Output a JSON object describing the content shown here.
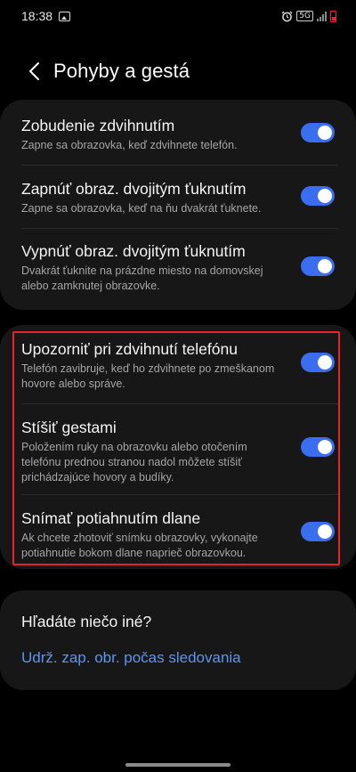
{
  "status_bar": {
    "time": "18:38",
    "network": "5G"
  },
  "header": {
    "title": "Pohyby a gestá"
  },
  "group_1": [
    {
      "title": "Zobudenie zdvihnutím",
      "desc": "Zapne sa obrazovka, keď zdvihnete telefón.",
      "enabled": true
    },
    {
      "title": "Zapnúť obraz. dvojitým ťuknutím",
      "desc": "Zapne sa obrazovka, keď na ňu dvakrát ťuknete.",
      "enabled": true
    },
    {
      "title": "Vypnúť obraz. dvojitým ťuknutím",
      "desc": "Dvakrát ťuknite na prázdne miesto na domovskej alebo zamknutej obrazovke.",
      "enabled": true
    }
  ],
  "group_2": [
    {
      "title": "Upozorniť pri zdvihnutí telefónu",
      "desc": "Telefón zavibruje, keď ho zdvihnete po zmeškanom hovore alebo správe.",
      "enabled": true
    },
    {
      "title": "Stíšiť gestami",
      "desc": "Položením ruky na obrazovku alebo otočením telefónu prednou stranou nadol môžete stíšiť prichádzajúce hovory a budíky.",
      "enabled": true
    },
    {
      "title": "Snímať potiahnutím dlane",
      "desc": "Ak chcete zhotoviť snímku obrazovky, vykonajte potiahnutie bokom dlane naprieč obrazovkou.",
      "enabled": true
    }
  ],
  "suggestions": {
    "title": "Hľadáte niečo iné?",
    "link": "Udrž. zap. obr. počas sledovania"
  },
  "colors": {
    "accent": "#3a6df0",
    "link": "#5d95ef",
    "highlight": "#e8242b",
    "card": "#171717"
  }
}
